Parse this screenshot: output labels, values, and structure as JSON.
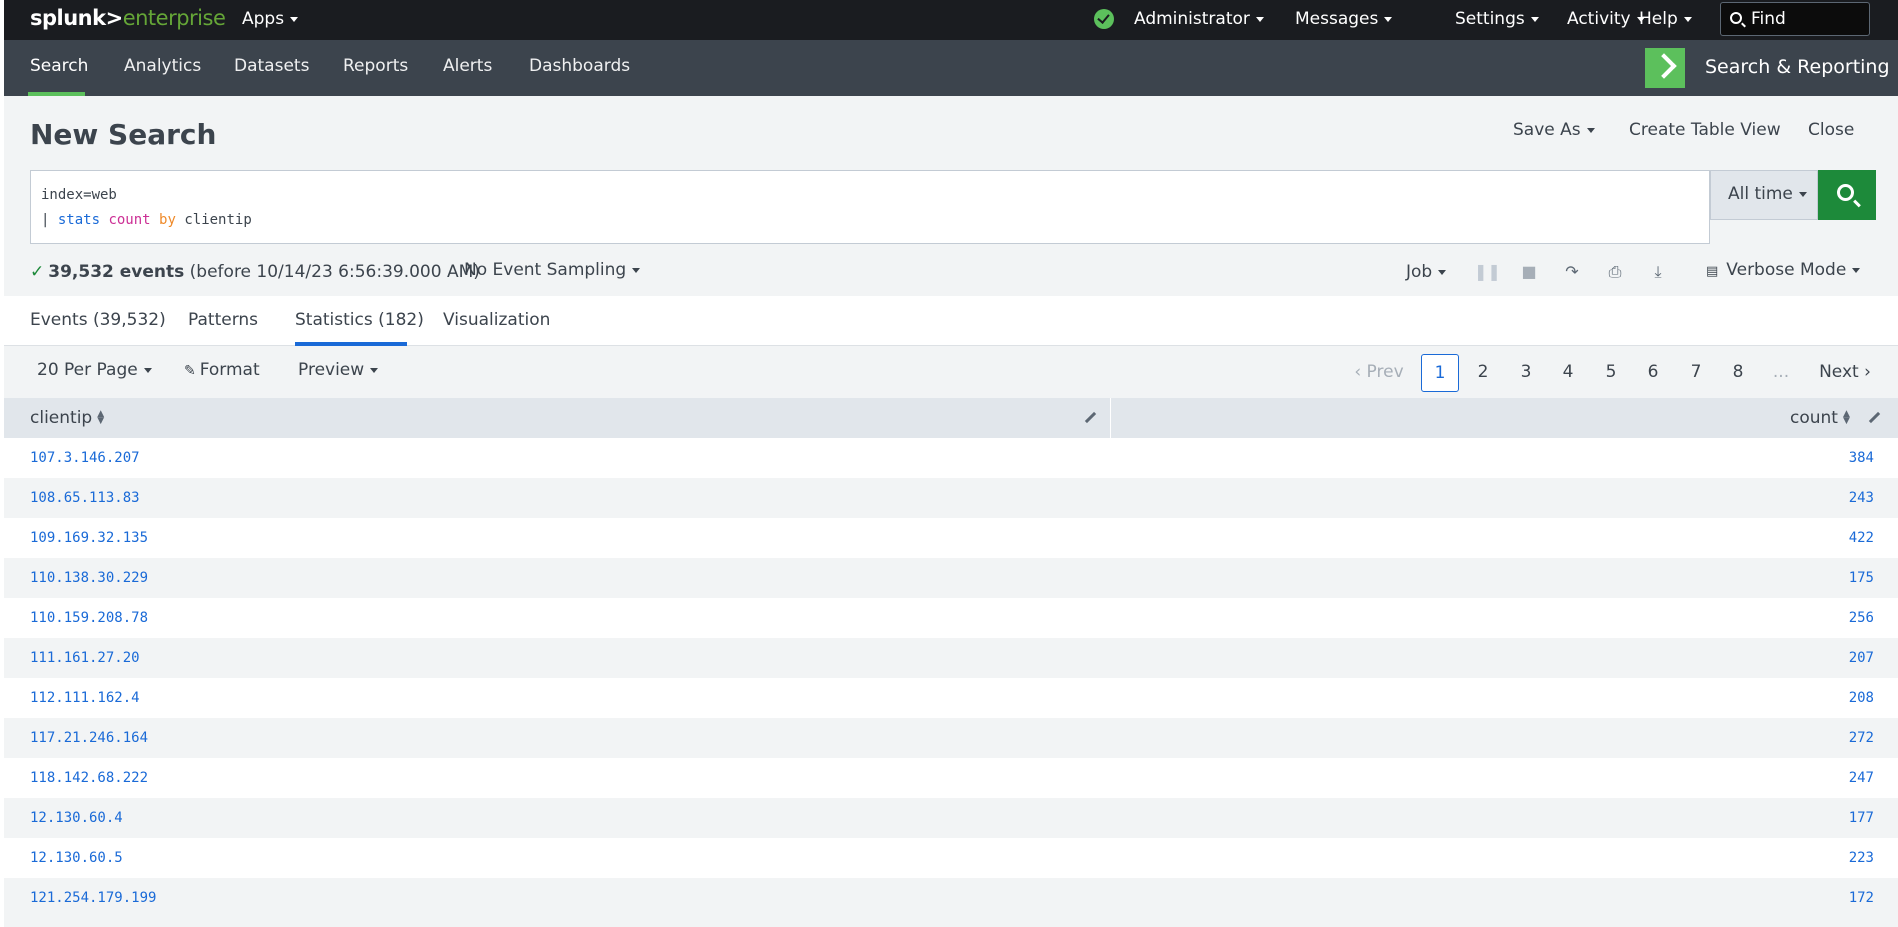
{
  "topbar": {
    "logo_main": "splunk>",
    "logo_suffix": "enterprise",
    "apps_label": "Apps",
    "menus": [
      "Administrator",
      "Messages",
      "Settings",
      "Activity",
      "Help"
    ],
    "find_placeholder": "Find"
  },
  "appbar": {
    "tabs": [
      "Search",
      "Analytics",
      "Datasets",
      "Reports",
      "Alerts",
      "Dashboards"
    ],
    "active_tab": "Search",
    "app_name": "Search & Reporting"
  },
  "search": {
    "title": "New Search",
    "save_as": "Save As",
    "create_table_view": "Create Table View",
    "close": "Close",
    "query_line1": "index=web",
    "query_pipe": "| ",
    "query_cmd": "stats",
    "query_fn": "count",
    "query_by": "by",
    "query_field": "clientip",
    "time_range": "All time",
    "events_count": "39,532 events",
    "events_detail": "(before 10/14/23 6:56:39.000 AM)",
    "sampling": "No Event Sampling",
    "job": "Job",
    "mode": "Verbose Mode"
  },
  "results": {
    "tabs": [
      "Events (39,532)",
      "Patterns",
      "Statistics (182)",
      "Visualization"
    ],
    "active_tab": "Statistics (182)",
    "per_page": "20 Per Page",
    "format": "Format",
    "preview": "Preview",
    "pager": {
      "prev": "Prev",
      "next": "Next",
      "pages": [
        "1",
        "2",
        "3",
        "4",
        "5",
        "6",
        "7",
        "8",
        "..."
      ],
      "current": "1"
    },
    "columns": [
      "clientip",
      "count"
    ],
    "rows": [
      [
        "107.3.146.207",
        "384"
      ],
      [
        "108.65.113.83",
        "243"
      ],
      [
        "109.169.32.135",
        "422"
      ],
      [
        "110.138.30.229",
        "175"
      ],
      [
        "110.159.208.78",
        "256"
      ],
      [
        "111.161.27.20",
        "207"
      ],
      [
        "112.111.162.4",
        "208"
      ],
      [
        "117.21.246.164",
        "272"
      ],
      [
        "118.142.68.222",
        "247"
      ],
      [
        "12.130.60.4",
        "177"
      ],
      [
        "12.130.60.5",
        "223"
      ],
      [
        "121.254.179.199",
        "172"
      ]
    ]
  },
  "colors": {
    "topbar_bg": "#1a1c20",
    "appbar_bg": "#3c444d",
    "accent_green": "#5cc05c",
    "search_button": "#1d8a3a",
    "link_blue": "#1a6ad7"
  }
}
